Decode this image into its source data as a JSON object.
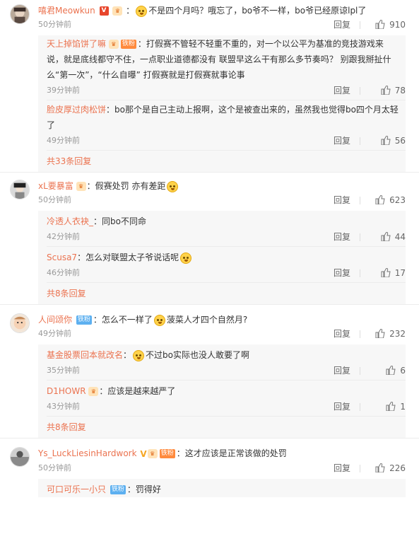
{
  "reply_label": "回复",
  "comments": [
    {
      "user": "嘻君Meowkun",
      "text_before": "不是四个月吗？哦忘了，bo爷不一样，bo爷已经原谅lpl了",
      "time": "50分钟前",
      "likes": "910",
      "replies": [
        {
          "user": "天上掉馅饼了嘛",
          "badge": "铁粉",
          "text": "：打假赛不管轻不轻重不重的，对一个以公平为基准的竞技游戏来说，就是底线都守不住，一点职业道德都没有 联盟早这么干有那么多节奏吗？ 别跟我掰扯什么“第一次”，“什么自曝” 打假赛就是打假赛就事论事",
          "time": "39分钟前",
          "likes": "78"
        },
        {
          "user": "脸皮厚过肉松饼",
          "text": "：bo那个是自己主动上报啊，这个是被查出来的，虽然我也觉得bo四个月太轻了",
          "time": "49分钟前",
          "likes": "56"
        }
      ],
      "more": "共33条回复"
    },
    {
      "user": "xL要暴富",
      "text_before": "：假赛处罚 亦有差距",
      "time": "50分钟前",
      "likes": "623",
      "replies": [
        {
          "user": "冷透人衣袂_",
          "text": "：同bo不同命",
          "time": "42分钟前",
          "likes": "44"
        },
        {
          "user": "Scusa7",
          "text": "：怎么对联盟太子爷说话呢",
          "time": "46分钟前",
          "likes": "17"
        }
      ],
      "more": "共8条回复"
    },
    {
      "user": "人间颂你",
      "badge": "铁粉",
      "text_before": "：怎么不一样了",
      "text_after": "菠菜人才四个自然月?",
      "time": "49分钟前",
      "likes": "232",
      "replies": [
        {
          "user": "基金股票回本就改名",
          "text_before": "：",
          "text": "不过bo实际也没人敢要了啊",
          "time": "35分钟前",
          "likes": "6"
        },
        {
          "user": "D1HOWR",
          "text": "：应该是越来越严了",
          "time": "43分钟前",
          "likes": "1"
        }
      ],
      "more": "共8条回复"
    },
    {
      "user": "Ys_LuckLiesinHardwork",
      "badge": "铁粉",
      "text_before": "：这才应该是正常该做的处罚",
      "time": "50分钟前",
      "likes": "226",
      "replies": [
        {
          "user": "可口可乐一小只",
          "badge": "铁粉",
          "text": "：罚得好"
        }
      ]
    }
  ]
}
